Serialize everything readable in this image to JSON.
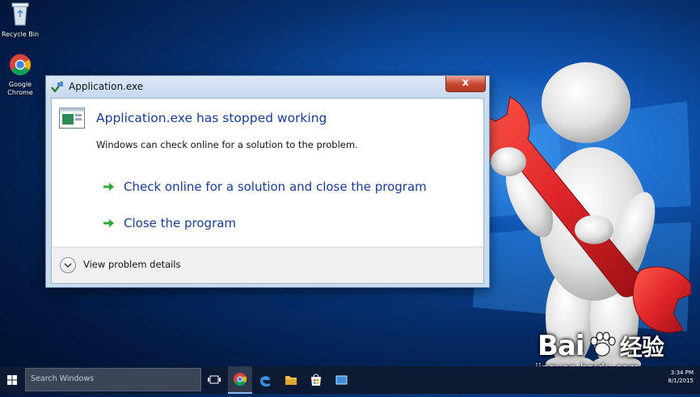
{
  "desktop": {
    "icons": [
      {
        "name": "recycle-bin",
        "label": "Recycle Bin"
      },
      {
        "name": "google-chrome",
        "label": "Google Chrome"
      }
    ]
  },
  "dialog": {
    "window_title": "Application.exe",
    "close_label": "x",
    "main_instruction": "Application.exe has stopped working",
    "content": "Windows can check online for a solution to the problem.",
    "commands": [
      "Check online for a solution and close the program",
      "Close the program"
    ],
    "expand_label": "View problem details"
  },
  "taskbar": {
    "search_placeholder": "Search Windows",
    "pinned": [
      "task-view-icon",
      "chrome-icon",
      "edge-icon",
      "file-explorer-icon",
      "store-icon",
      "app-icon"
    ],
    "clock_time": "3:34 PM",
    "clock_date": "8/1/2015"
  },
  "watermark": {
    "brand_text": "Bai",
    "brand_cn": "经验",
    "url": "jingyan.baidu.com"
  },
  "colors": {
    "link_blue": "#1b3b8f",
    "close_red": "#c74530",
    "wrench_red": "#e0262a",
    "taskbar": "#0c1a33"
  }
}
